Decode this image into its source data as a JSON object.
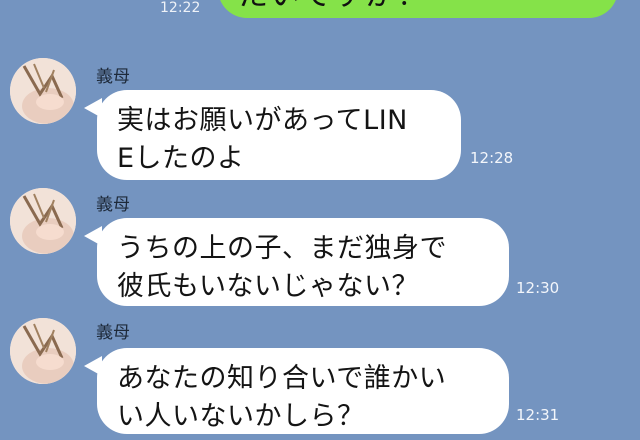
{
  "top_message": {
    "text": "たいですか？",
    "time": "12:22"
  },
  "messages": [
    {
      "sender": "義母",
      "lines": [
        "実はお願いがあってLIN",
        "Eしたのよ"
      ],
      "time": "12:28"
    },
    {
      "sender": "義母",
      "lines": [
        "うちの上の子、まだ独身で",
        "彼氏もいないじゃない？"
      ],
      "time": "12:30"
    },
    {
      "sender": "義母",
      "lines": [
        "あなたの知り合いで誰かい",
        "い人いないかしら？"
      ],
      "time": "12:31"
    }
  ],
  "colors": {
    "background": "#7494c0",
    "outgoing_bubble": "#85e249",
    "incoming_bubble": "#ffffff"
  }
}
